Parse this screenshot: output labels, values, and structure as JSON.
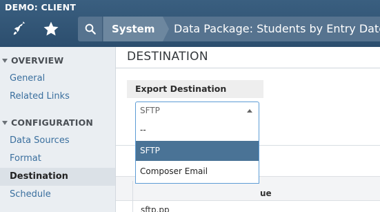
{
  "header": {
    "client_label": "DEMO: CLIENT",
    "icons": [
      "rocket-icon",
      "star-icon",
      "search-icon"
    ],
    "breadcrumb": {
      "system": "System",
      "page": "Data Package: Students by Entry Date"
    }
  },
  "sidebar": {
    "sections": [
      {
        "title": "OVERVIEW",
        "items": [
          {
            "label": "General",
            "active": false
          },
          {
            "label": "Related Links",
            "active": false
          }
        ]
      },
      {
        "title": "CONFIGURATION",
        "items": [
          {
            "label": "Data Sources",
            "active": false
          },
          {
            "label": "Format",
            "active": false
          },
          {
            "label": "Destination",
            "active": true
          },
          {
            "label": "Schedule",
            "active": false
          }
        ]
      }
    ]
  },
  "main": {
    "title": "DESTINATION",
    "export_destination": {
      "label": "Export Destination",
      "selected": "SFTP",
      "options": [
        "--",
        "SFTP",
        "Composer Email"
      ]
    },
    "table": {
      "column_value_fragment": "ue",
      "row_fragment": "sftp.pp"
    }
  },
  "colors": {
    "topbar": "#2c4e6e",
    "crumb_system_bg": "#6d879f",
    "selected_option_bg": "#4a7396",
    "link": "#3a6f9e",
    "focus_border": "#5b9bd5"
  }
}
